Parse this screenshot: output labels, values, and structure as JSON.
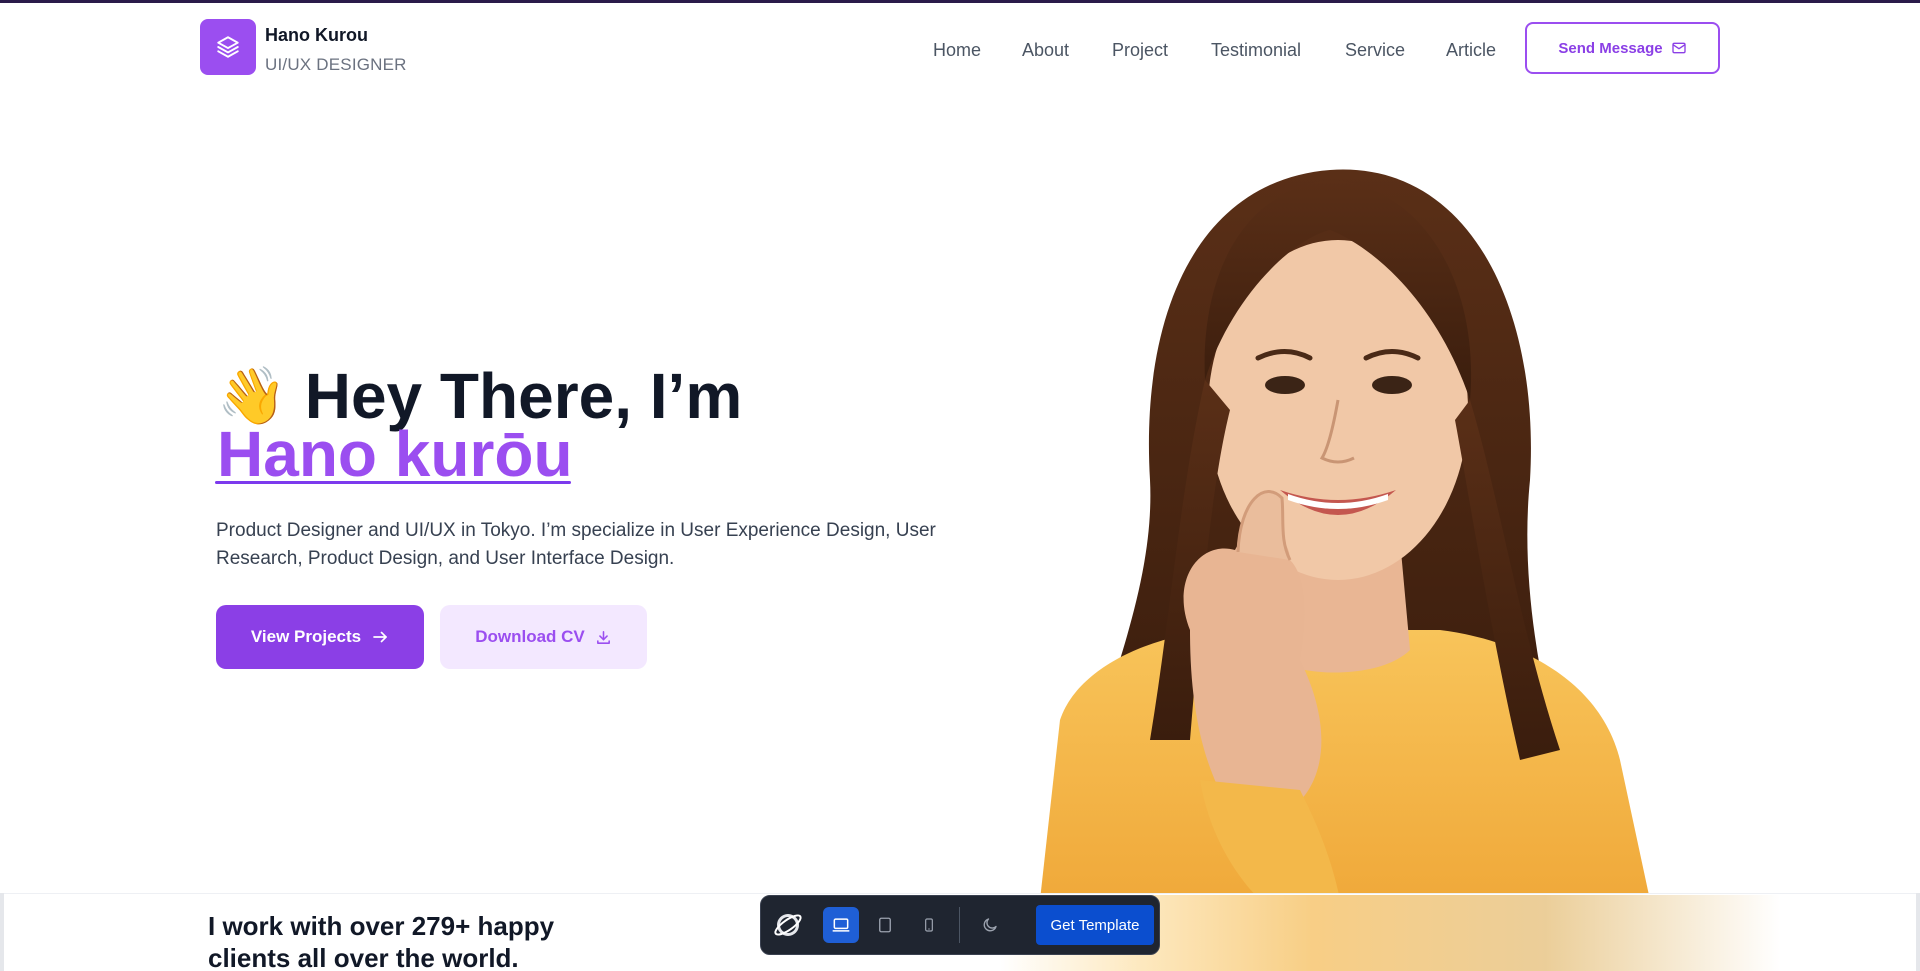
{
  "brand": {
    "name": "Hano Kurou",
    "role": "UI/UX DESIGNER",
    "logo_icon": "layers-icon"
  },
  "nav": {
    "items": [
      {
        "label": "Home"
      },
      {
        "label": "About"
      },
      {
        "label": "Project"
      },
      {
        "label": "Testimonial"
      },
      {
        "label": "Service"
      },
      {
        "label": "Article"
      }
    ],
    "cta_label": "Send Message",
    "cta_icon": "mail-icon"
  },
  "hero": {
    "greeting_emoji": "👋",
    "greeting": "Hey There, I’m",
    "name": "Hano kurōu",
    "description": "Product Designer and UI/UX in Tokyo. I’m specialize in User Experience Design, User Research, Product Design, and User Interface Design.",
    "primary_button": "View Projects",
    "primary_icon": "arrow-right-icon",
    "secondary_button": "Download CV",
    "secondary_icon": "download-icon"
  },
  "clients": {
    "text": "I work with over 279+ happy clients all over the world."
  },
  "toolbar": {
    "logo_icon": "planet-logo-icon",
    "devices": [
      "desktop-icon",
      "tablet-icon",
      "mobile-icon"
    ],
    "active_device": "desktop-icon",
    "theme_icon": "moon-icon",
    "get_template_label": "Get Template"
  },
  "colors": {
    "accent": "#9b4ef0",
    "accent_dark": "#8b3fe6",
    "accent_light": "#f3e8ff",
    "text_dark": "#111827",
    "toolbar_bg": "#1f2530",
    "toolbar_blue": "#0b4ecf"
  }
}
